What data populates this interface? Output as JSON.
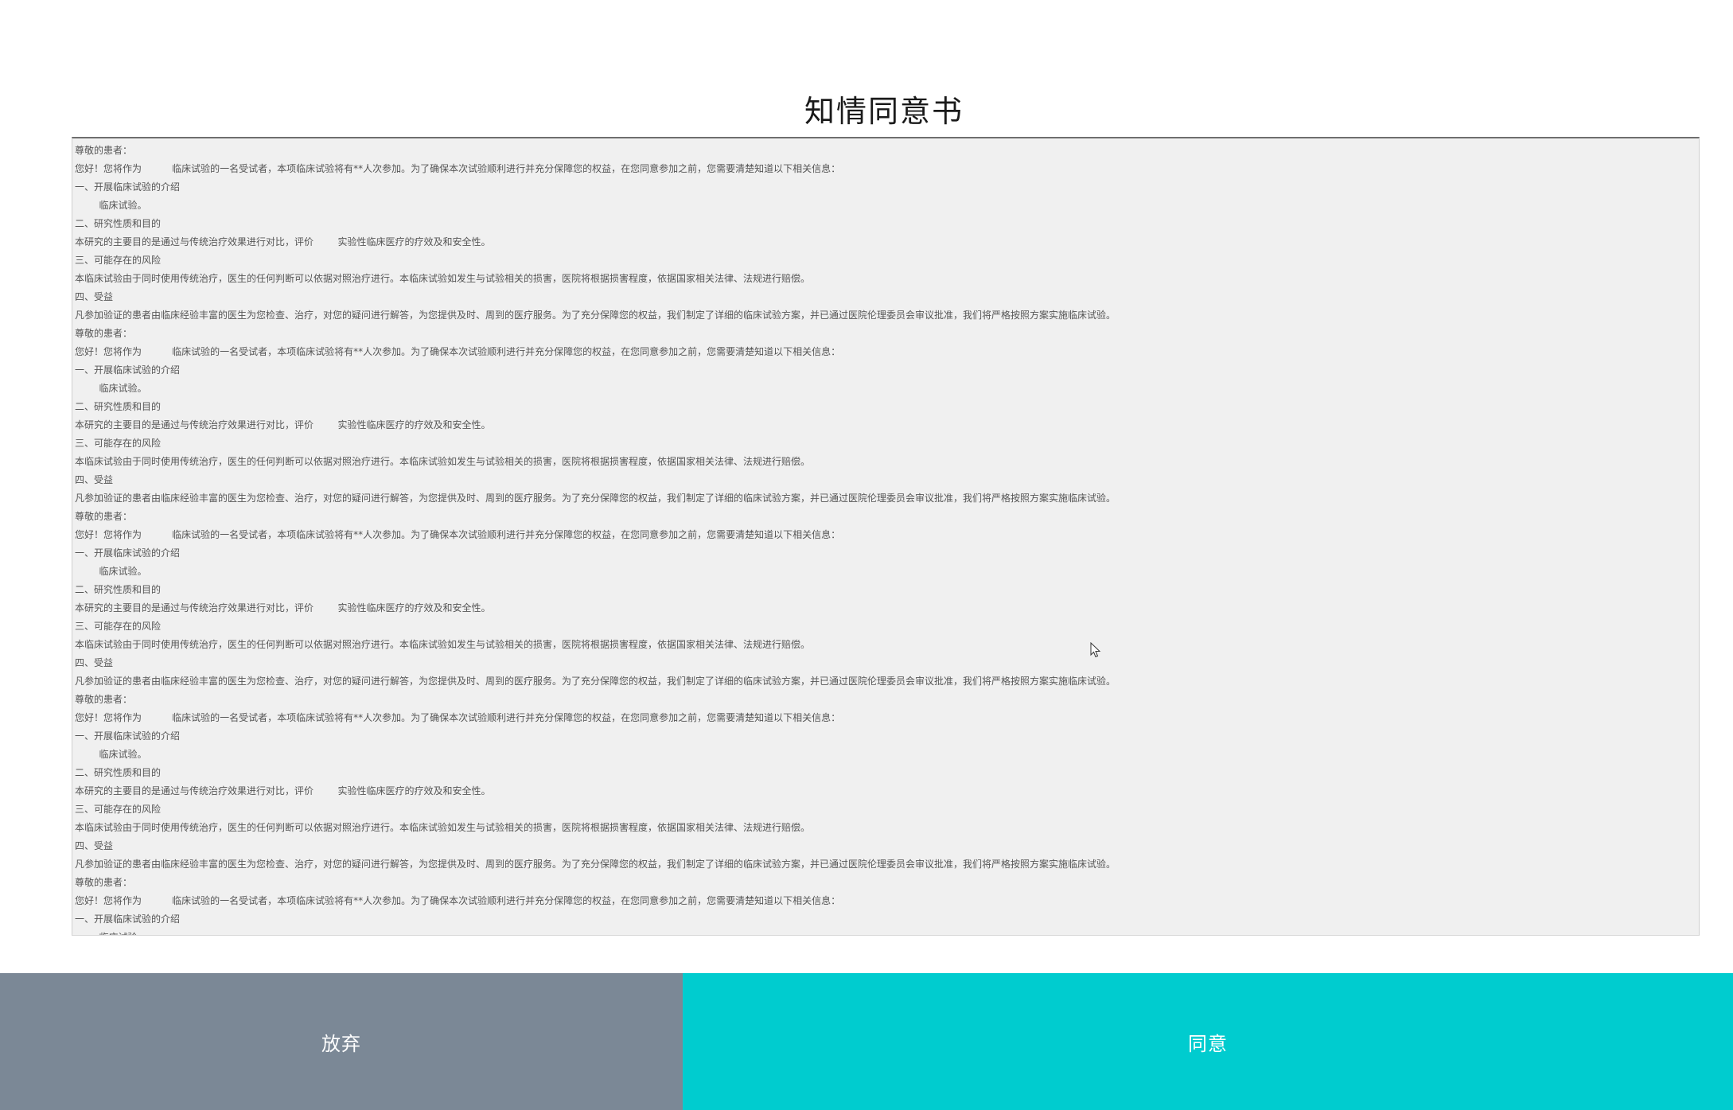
{
  "page": {
    "title": "知情同意书"
  },
  "consent": {
    "lines": [
      "尊敬的患者：",
      "您好！您将作为          临床试验的一名受试者，本项临床试验将有**人次参加。为了确保本次试验顺利进行并充分保障您的权益，在您同意参加之前，您需要清楚知道以下相关信息：",
      "一、开展临床试验的介绍",
      "        临床试验。",
      "二、研究性质和目的",
      "本研究的主要目的是通过与传统治疗效果进行对比，评价        实验性临床医疗的疗效及和安全性。",
      "三、可能存在的风险",
      "本临床试验由于同时使用传统治疗，医生的任何判断可以依据对照治疗进行。本临床试验如发生与试验相关的损害，医院将根据损害程度，依据国家相关法律、法规进行赔偿。",
      "四、受益",
      "凡参加验证的患者由临床经验丰富的医生为您检查、治疗，对您的疑问进行解答，为您提供及时、周到的医疗服务。为了充分保障您的权益，我们制定了详细的临床试验方案，并已通过医院伦理委员会审议批准，我们将严格按照方案实施临床试验。",
      "尊敬的患者：",
      "您好！您将作为          临床试验的一名受试者，本项临床试验将有**人次参加。为了确保本次试验顺利进行并充分保障您的权益，在您同意参加之前，您需要清楚知道以下相关信息：",
      "一、开展临床试验的介绍",
      "        临床试验。",
      "二、研究性质和目的",
      "本研究的主要目的是通过与传统治疗效果进行对比，评价        实验性临床医疗的疗效及和安全性。",
      "三、可能存在的风险",
      "本临床试验由于同时使用传统治疗，医生的任何判断可以依据对照治疗进行。本临床试验如发生与试验相关的损害，医院将根据损害程度，依据国家相关法律、法规进行赔偿。",
      "四、受益",
      "凡参加验证的患者由临床经验丰富的医生为您检查、治疗，对您的疑问进行解答，为您提供及时、周到的医疗服务。为了充分保障您的权益，我们制定了详细的临床试验方案，并已通过医院伦理委员会审议批准，我们将严格按照方案实施临床试验。",
      "尊敬的患者：",
      "您好！您将作为          临床试验的一名受试者，本项临床试验将有**人次参加。为了确保本次试验顺利进行并充分保障您的权益，在您同意参加之前，您需要清楚知道以下相关信息：",
      "一、开展临床试验的介绍",
      "        临床试验。",
      "二、研究性质和目的",
      "本研究的主要目的是通过与传统治疗效果进行对比，评价        实验性临床医疗的疗效及和安全性。",
      "三、可能存在的风险",
      "本临床试验由于同时使用传统治疗，医生的任何判断可以依据对照治疗进行。本临床试验如发生与试验相关的损害，医院将根据损害程度，依据国家相关法律、法规进行赔偿。",
      "四、受益",
      "凡参加验证的患者由临床经验丰富的医生为您检查、治疗，对您的疑问进行解答，为您提供及时、周到的医疗服务。为了充分保障您的权益，我们制定了详细的临床试验方案，并已通过医院伦理委员会审议批准，我们将严格按照方案实施临床试验。",
      "尊敬的患者：",
      "您好！您将作为          临床试验的一名受试者，本项临床试验将有**人次参加。为了确保本次试验顺利进行并充分保障您的权益，在您同意参加之前，您需要清楚知道以下相关信息：",
      "一、开展临床试验的介绍",
      "        临床试验。",
      "二、研究性质和目的",
      "本研究的主要目的是通过与传统治疗效果进行对比，评价        实验性临床医疗的疗效及和安全性。",
      "三、可能存在的风险",
      "本临床试验由于同时使用传统治疗，医生的任何判断可以依据对照治疗进行。本临床试验如发生与试验相关的损害，医院将根据损害程度，依据国家相关法律、法规进行赔偿。",
      "四、受益",
      "凡参加验证的患者由临床经验丰富的医生为您检查、治疗，对您的疑问进行解答，为您提供及时、周到的医疗服务。为了充分保障您的权益，我们制定了详细的临床试验方案，并已通过医院伦理委员会审议批准，我们将严格按照方案实施临床试验。",
      "尊敬的患者：",
      "您好！您将作为          临床试验的一名受试者，本项临床试验将有**人次参加。为了确保本次试验顺利进行并充分保障您的权益，在您同意参加之前，您需要清楚知道以下相关信息：",
      "一、开展临床试验的介绍",
      "        临床试验。"
    ]
  },
  "actions": {
    "abandon_label": "放弃",
    "agree_label": "同意"
  },
  "colors": {
    "abandon_bg": "#7b8896",
    "agree_bg": "#00cccf",
    "content_bg": "#f0f0f0"
  },
  "icons": {
    "cursor": "mouse-pointer-icon"
  }
}
